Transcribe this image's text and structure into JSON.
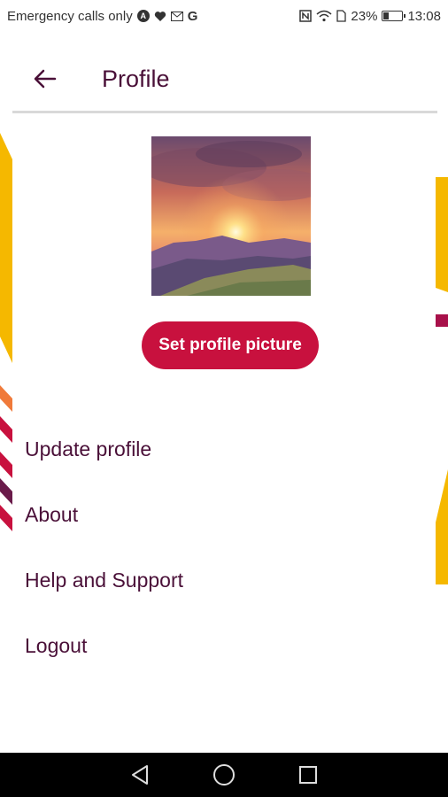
{
  "status_bar": {
    "carrier_text": "Emergency calls only",
    "battery_percent": "23%",
    "battery_level": 0.23,
    "time": "13:08",
    "left_icons": [
      "app-a-icon",
      "heart-icon",
      "mail-icon",
      "google-g-icon"
    ],
    "right_icons": [
      "nfc-icon",
      "wifi-icon",
      "sim-icon",
      "battery-icon"
    ]
  },
  "app_bar": {
    "back_icon": "arrow-left-icon",
    "title": "Profile"
  },
  "profile": {
    "image": "sunset-mountain-photo",
    "set_picture_label": "Set profile picture"
  },
  "menu": {
    "items": [
      {
        "label": "Update profile"
      },
      {
        "label": "About"
      },
      {
        "label": "Help and Support"
      },
      {
        "label": "Logout"
      }
    ]
  },
  "nav_bar": {
    "icons": [
      "back-triangle-icon",
      "home-circle-icon",
      "recents-square-icon"
    ]
  },
  "colors": {
    "accent": "#c8113e",
    "text": "#4a1038",
    "deco_yellow": "#f5b800"
  }
}
